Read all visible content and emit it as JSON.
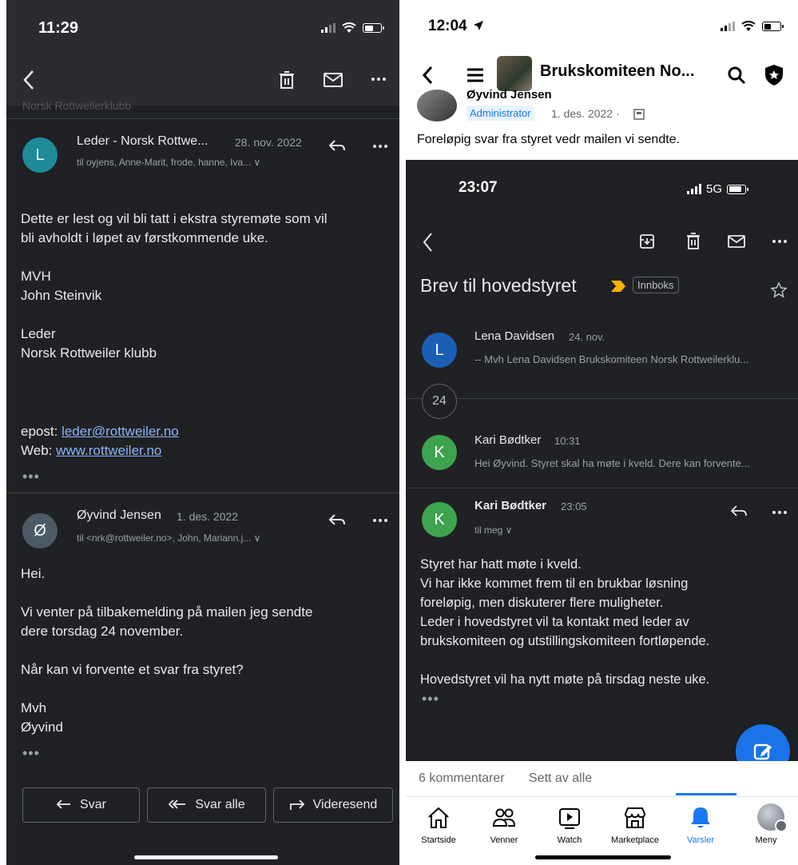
{
  "left": {
    "status_time": "11:29",
    "faded_header": "Norsk Rottweilerklubb",
    "messages": [
      {
        "avatar_letter": "L",
        "avatar_color": "#1e8a9a",
        "sender": "Leder - Norsk Rottwe...",
        "date": "28. nov. 2022",
        "recipients": "til oyjens, Anne-Marit, frode, hanne, Iva... ∨",
        "body": "Dette er lest og vil bli tatt i ekstra styremøte som vil\nbli avholdt i løpet av førstkommende uke.\n\nMVH\nJohn Steinvik\n\nLeder\nNorsk Rottweiler klubb",
        "email_label": "epost:",
        "email_link": "leder@rottweiler.no",
        "web_label": "Web:",
        "web_link": "www.rottweiler.no",
        "more": "•••"
      },
      {
        "avatar_letter": "Ø",
        "avatar_color": "#4a5a66",
        "sender": "Øyvind Jensen",
        "date": "1. des. 2022",
        "recipients": "til <nrk@rottweiler.no>, John, Mariann.j... ∨",
        "body": "Hei.\n\nVi venter på tilbakemelding på mailen jeg sendte\ndere torsdag 24 november.\n\nNår kan vi forvente et svar fra styret?\n\nMvh\nØyvind",
        "more": "•••"
      }
    ],
    "buttons": {
      "reply": "Svar",
      "reply_all": "Svar alle",
      "forward": "Videresend"
    }
  },
  "right": {
    "status_time": "12:04",
    "group_title": "Brukskomiteen No...",
    "post": {
      "author_partial": "Øyvind Jensen",
      "badge": "Administrator",
      "meta": "1. des. 2022 ·",
      "text": "Foreløpig svar fra styret vedr mailen vi sendte."
    },
    "embedded": {
      "status_time": "23:07",
      "network": "5G",
      "subject": "Brev til hovedstyret",
      "label": "Innboks",
      "hidden_count": "24",
      "threads": [
        {
          "avatar_letter": "L",
          "avatar_color": "#1a5fb4",
          "sender": "Lena Davidsen",
          "date": "24. nov.",
          "snippet": "-- Mvh Lena Davidsen Brukskomiteen Norsk Rottweilerklu..."
        },
        {
          "avatar_letter": "K",
          "avatar_color": "#3ea34f",
          "sender": "Kari Bødtker",
          "date": "10:31",
          "snippet": "Hei Øyvind. Styret skal ha møte i kveld. Dere kan forvente..."
        }
      ],
      "open_message": {
        "avatar_letter": "K",
        "avatar_color": "#3ea34f",
        "sender": "Kari Bødtker",
        "date": "23:05",
        "recipients": "til meg ∨",
        "body": "Styret har hatt møte i kveld.\nVi har ikke kommet frem til en brukbar løsning\nforeløpig, men diskuterer flere muligheter.\nLeder i hovedstyret vil ta kontakt med leder av\nbrukskomiteen og utstillingskomiteen fortløpende.\n\nHovedstyret vil ha nytt møte på tirsdag neste uke.",
        "more": "•••"
      }
    },
    "comments": "6 kommentarer",
    "seen": "Sett av alle",
    "tabs": [
      {
        "label": "Startside",
        "icon": "home-icon"
      },
      {
        "label": "Venner",
        "icon": "friends-icon"
      },
      {
        "label": "Watch",
        "icon": "watch-icon"
      },
      {
        "label": "Marketplace",
        "icon": "marketplace-icon"
      },
      {
        "label": "Varsler",
        "icon": "bell-icon",
        "active": true
      },
      {
        "label": "Meny",
        "icon": "avatar-icon"
      }
    ],
    "accent_color": "#1877f2"
  }
}
